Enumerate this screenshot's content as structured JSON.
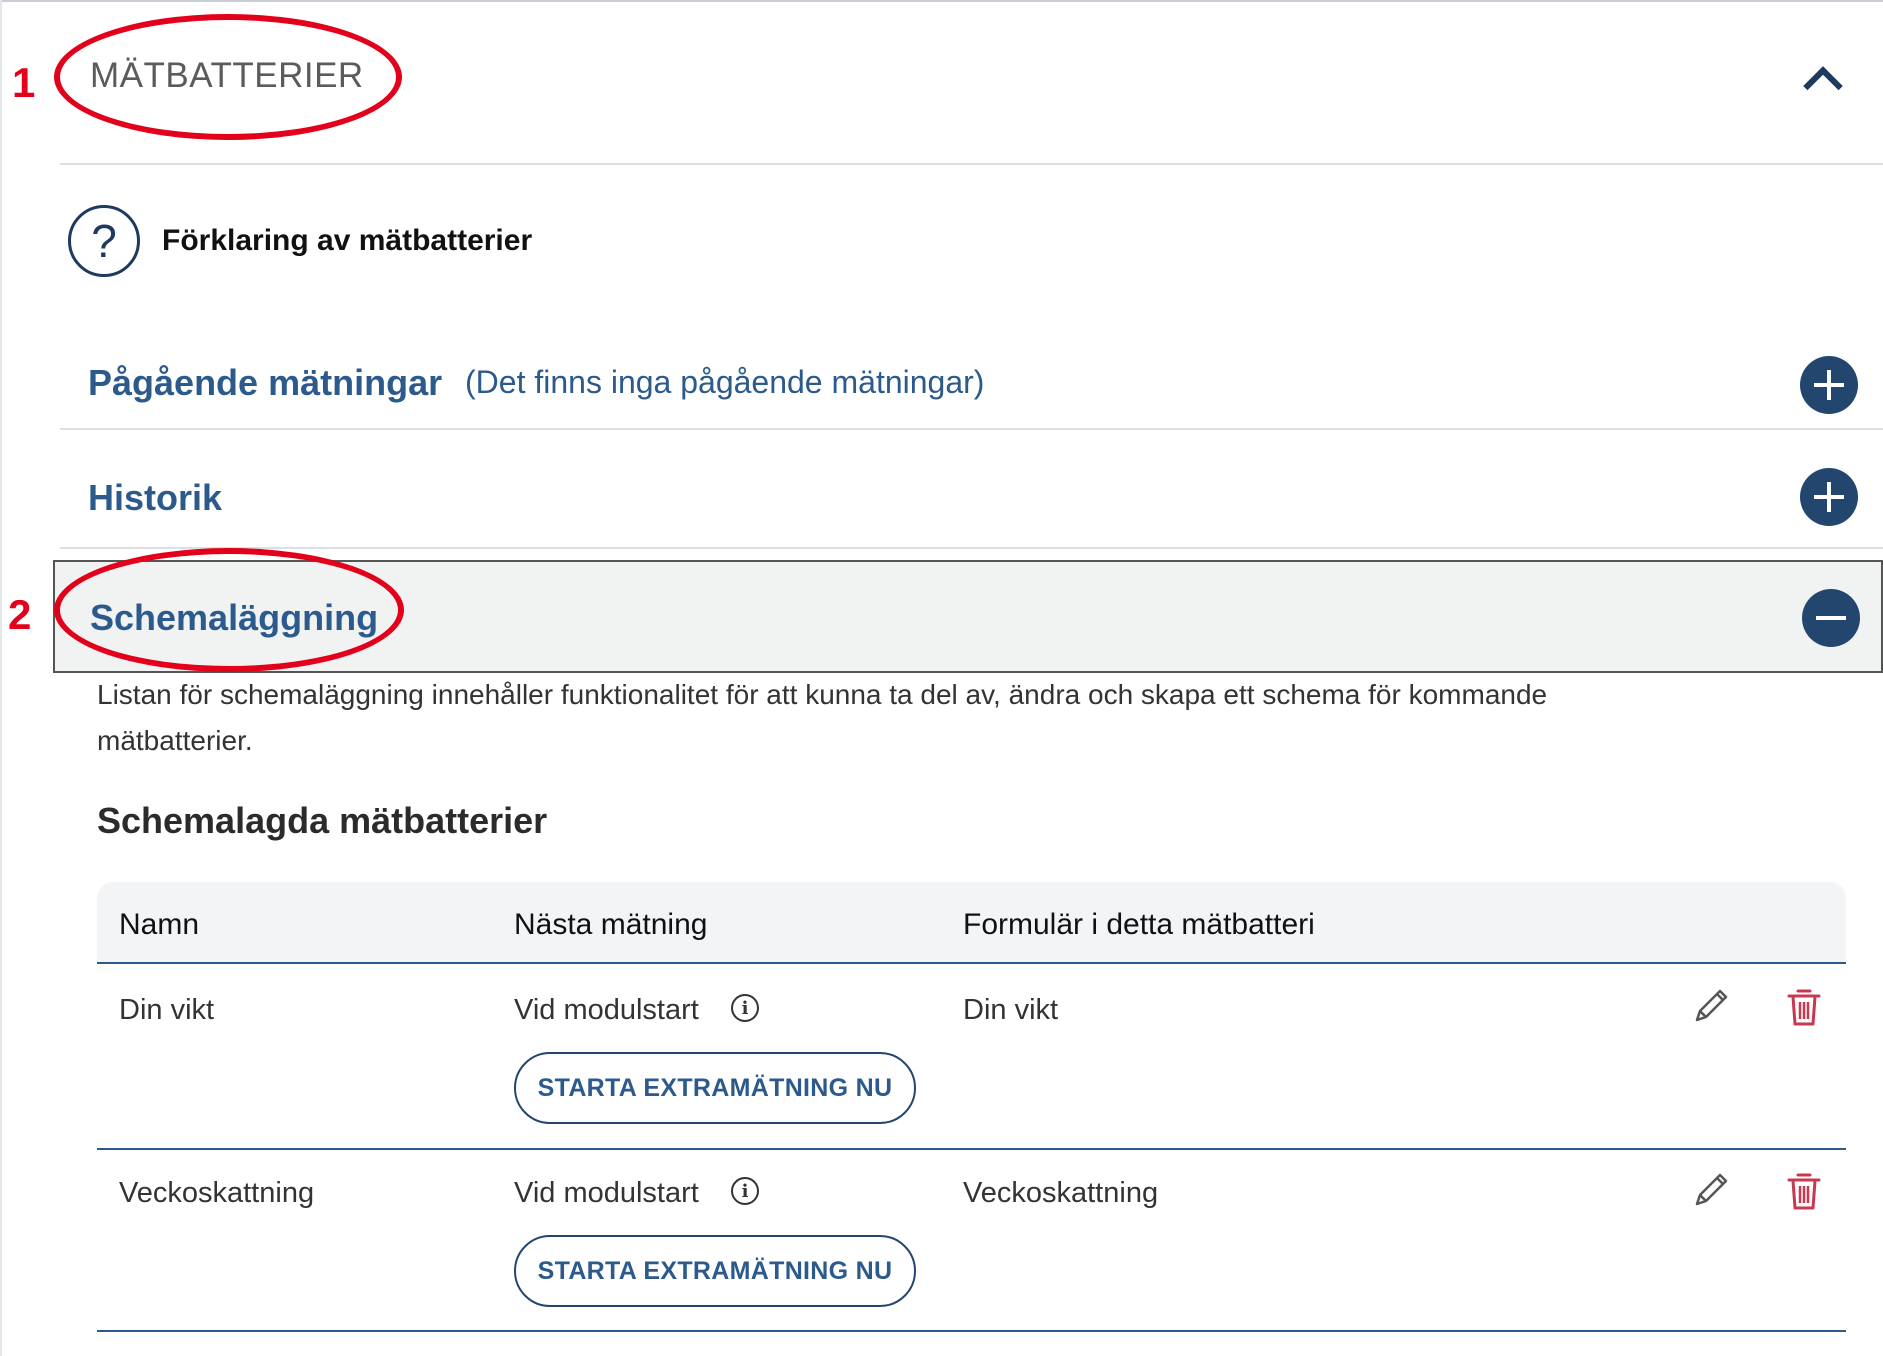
{
  "annotations": {
    "marker_1": "1",
    "marker_2": "2"
  },
  "panel": {
    "title": "MÄTBATTERIER"
  },
  "help": {
    "icon_glyph": "?",
    "label": "Förklaring av mätbatterier"
  },
  "accordions": [
    {
      "title": "Pågående mätningar",
      "subtitle": "(Det finns inga pågående mätningar)",
      "state": "collapsed"
    },
    {
      "title": "Historik",
      "state": "collapsed"
    },
    {
      "title": "Schemaläggning",
      "state": "expanded"
    }
  ],
  "schedule": {
    "description_line1": "Listan för schemaläggning innehåller funktionalitet för att kunna ta del av, ändra och skapa ett schema för kommande",
    "description_line2": "mätbatterier.",
    "section_title": "Schemalagda mätbatterier",
    "columns": [
      "Namn",
      "Nästa mätning",
      "Formulär i detta mätbatteri"
    ],
    "rows": [
      {
        "name": "Din vikt",
        "next": "Vid modulstart",
        "button": "STARTA EXTRAMÄTNING NU",
        "forms": "Din vikt"
      },
      {
        "name": "Veckoskattning",
        "next": "Vid modulstart",
        "button": "STARTA EXTRAMÄTNING NU",
        "forms": "Veckoskattning"
      }
    ]
  },
  "colors": {
    "accent": "#2c5a8c",
    "dark_button": "#23466f",
    "annotation": "#e3001b",
    "delete": "#c8384f"
  },
  "icons": [
    "chevron-up-icon",
    "question-icon",
    "plus-icon",
    "minus-icon",
    "info-icon",
    "pencil-icon",
    "trash-icon"
  ]
}
